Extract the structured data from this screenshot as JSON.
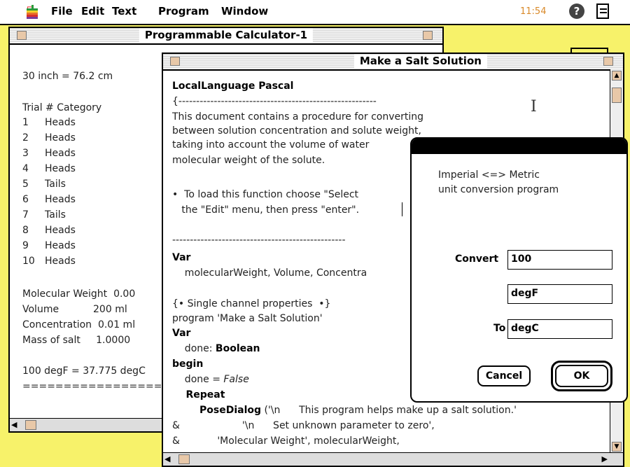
{
  "menu": {
    "file": "File",
    "edit": "Edit",
    "text": "Text",
    "program": "Program",
    "window": "Window",
    "clock": "11:54"
  },
  "calc": {
    "title": "Programmable Calculator-1",
    "inch": "30 inch = 76.2 cm",
    "trial_header": "Trial # Category",
    "trials": [
      {
        "n": "1",
        "c": "Heads"
      },
      {
        "n": "2",
        "c": "Heads"
      },
      {
        "n": "3",
        "c": "Heads"
      },
      {
        "n": "4",
        "c": "Heads"
      },
      {
        "n": "5",
        "c": "Tails"
      },
      {
        "n": "6",
        "c": "Heads"
      },
      {
        "n": "7",
        "c": "Tails"
      },
      {
        "n": "8",
        "c": "Heads"
      },
      {
        "n": "9",
        "c": "Heads"
      },
      {
        "n": "10",
        "c": "Heads"
      }
    ],
    "mw": "Molecular Weight  0.00",
    "vol": "Volume           200 ml",
    "conc": "Concentration  0.01 ml",
    "mass": "Mass of salt     1.0000",
    "degf": "100 degF = 37.775 degC",
    "rule": "=========================="
  },
  "salt": {
    "title": "Make a Salt Solution",
    "lines": {
      "l1": "LocalLanguage Pascal",
      "l2": "{--------------------------------------------------------",
      "l3": "This document contains a procedure for converting",
      "l4": "between solution concentration and solute weight,",
      "l5": "taking into account the volume of water",
      "l6": "molecular weight of the solute.",
      "l7": "•  To load this function choose \"Select",
      "l8": "   the \"Edit\" menu, then press \"enter\".",
      "l9": "-------------------------------------------------",
      "l10": "Var",
      "l11": "    molecularWeight, Volume, Concentra",
      "l12": "{• Single channel properties  •}",
      "l13": "program 'Make a Salt Solution'",
      "l14": "Var",
      "l15a": "    done: ",
      "l15b": "Boolean",
      "l16": "begin",
      "l17a": "    done = ",
      "l17b": "False",
      "l18": "    Repeat",
      "l19a": "        PoseDialog",
      "l19b": " ('\\n      This program helps make up a salt solution.'",
      "l20": "&                    '\\n      Set unknown parameter to zero',",
      "l21": "&            'Molecular Weight', molecularWeight,"
    }
  },
  "dialog": {
    "line1": "Imperial <=> Metric",
    "line2": "unit conversion program",
    "convert_label": "Convert",
    "convert_value": "100",
    "from_unit": "degF",
    "to_label": "To",
    "to_unit": "degC",
    "cancel": "Cancel",
    "ok": "OK"
  }
}
